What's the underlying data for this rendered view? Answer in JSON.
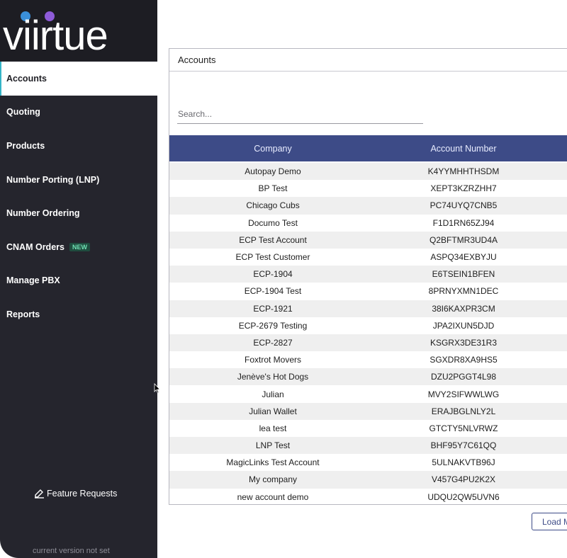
{
  "brand": {
    "logo_text": "viirtue",
    "colors": {
      "accent": "#35b4c7",
      "dot_left": "#3a8fd9",
      "dot_right": "#8e5bd8",
      "table_header": "#3d4b87",
      "sidebar": "#25252d"
    }
  },
  "sidebar": {
    "items": [
      {
        "label": "Accounts",
        "active": true
      },
      {
        "label": "Quoting"
      },
      {
        "label": "Products"
      },
      {
        "label": "Number Porting (LNP)"
      },
      {
        "label": "Number Ordering"
      },
      {
        "label": "CNAM Orders",
        "badge": "NEW"
      },
      {
        "label": "Manage PBX"
      },
      {
        "label": "Reports"
      }
    ],
    "feature_requests": {
      "label": "Feature Requests",
      "icon": "edit-icon"
    },
    "version": "current version not set"
  },
  "accounts": {
    "title": "Accounts",
    "search": {
      "placeholder": "Search...",
      "value": ""
    },
    "columns": [
      "Company",
      "Account Number"
    ],
    "rows": [
      {
        "company": "Autopay Demo",
        "account_number": "K4YYMHHTHSDM"
      },
      {
        "company": "BP Test",
        "account_number": "XEPT3KZRZHH7"
      },
      {
        "company": "Chicago Cubs",
        "account_number": "PC74UYQ7CNB5"
      },
      {
        "company": "Documo Test",
        "account_number": "F1D1RN65ZJ94"
      },
      {
        "company": "ECP Test Account",
        "account_number": "Q2BFTMR3UD4A"
      },
      {
        "company": "ECP Test Customer",
        "account_number": "ASPQ34EXBYJU"
      },
      {
        "company": "ECP-1904",
        "account_number": "E6TSEIN1BFEN"
      },
      {
        "company": "ECP-1904 Test",
        "account_number": "8PRNYXMN1DEC"
      },
      {
        "company": "ECP-1921",
        "account_number": "38I6KAXPR3CM"
      },
      {
        "company": "ECP-2679 Testing",
        "account_number": "JPA2IXUN5DJD"
      },
      {
        "company": "ECP-2827",
        "account_number": "KSGRX3DE31R3"
      },
      {
        "company": "Foxtrot Movers",
        "account_number": "SGXDR8XA9HS5"
      },
      {
        "company": "Jenève's Hot Dogs",
        "account_number": "DZU2PGGT4L98"
      },
      {
        "company": "Julian",
        "account_number": "MVY2SIFWWLWG"
      },
      {
        "company": "Julian Wallet",
        "account_number": "ERAJBGLNLY2L"
      },
      {
        "company": "lea test",
        "account_number": "GTCTY5NLVRWZ"
      },
      {
        "company": "LNP Test",
        "account_number": "BHF95Y7C61QQ"
      },
      {
        "company": "MagicLinks Test Account",
        "account_number": "5ULNAKVTB96J"
      },
      {
        "company": "My company",
        "account_number": "V457G4PU2K2X"
      },
      {
        "company": "new account demo",
        "account_number": "UDQU2QW5UVN6"
      }
    ],
    "load_more_label": "Load More"
  }
}
